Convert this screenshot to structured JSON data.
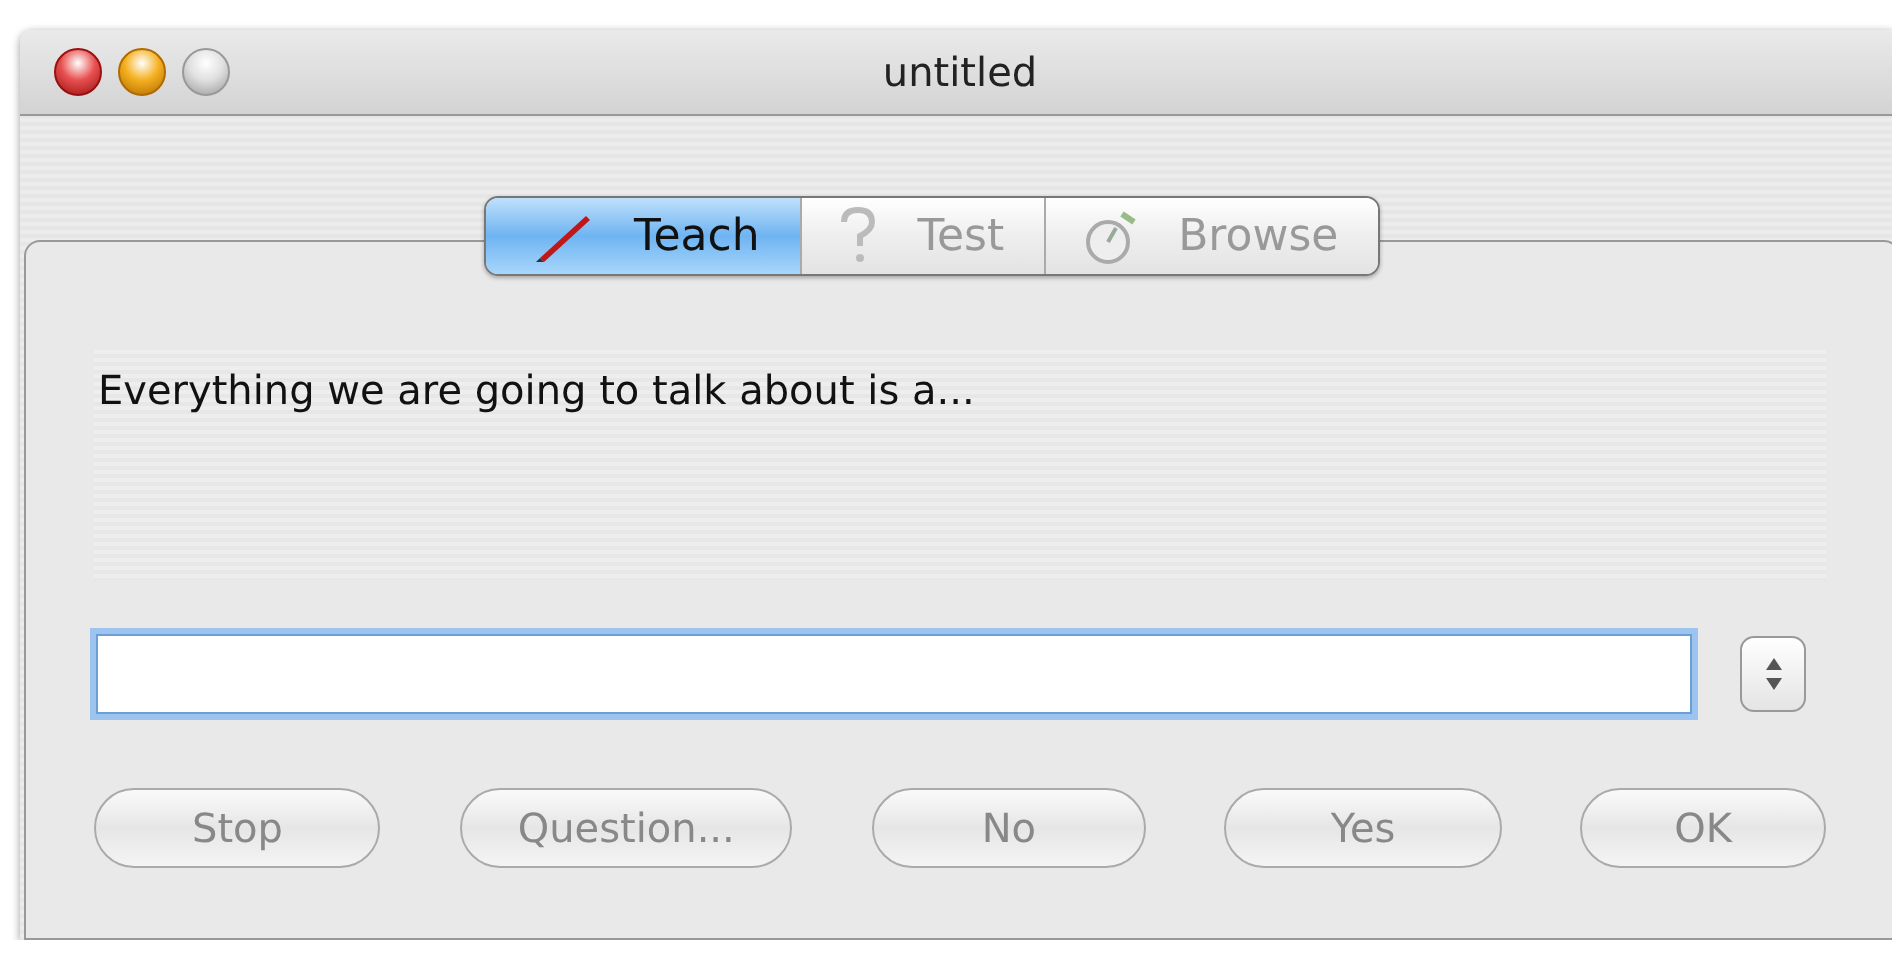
{
  "window": {
    "title": "untitled"
  },
  "tabs": [
    {
      "label": "Teach",
      "selected": true,
      "disabled": false
    },
    {
      "label": "Test",
      "selected": false,
      "disabled": true
    },
    {
      "label": "Browse",
      "selected": false,
      "disabled": true
    }
  ],
  "message": "Everything we are going to talk about is a...",
  "buttons": [
    {
      "label": "Stop",
      "disabled": true
    },
    {
      "label": "Question...",
      "disabled": true
    },
    {
      "label": "No",
      "disabled": true
    },
    {
      "label": "Yes",
      "disabled": true
    },
    {
      "label": "OK",
      "disabled": true
    }
  ]
}
